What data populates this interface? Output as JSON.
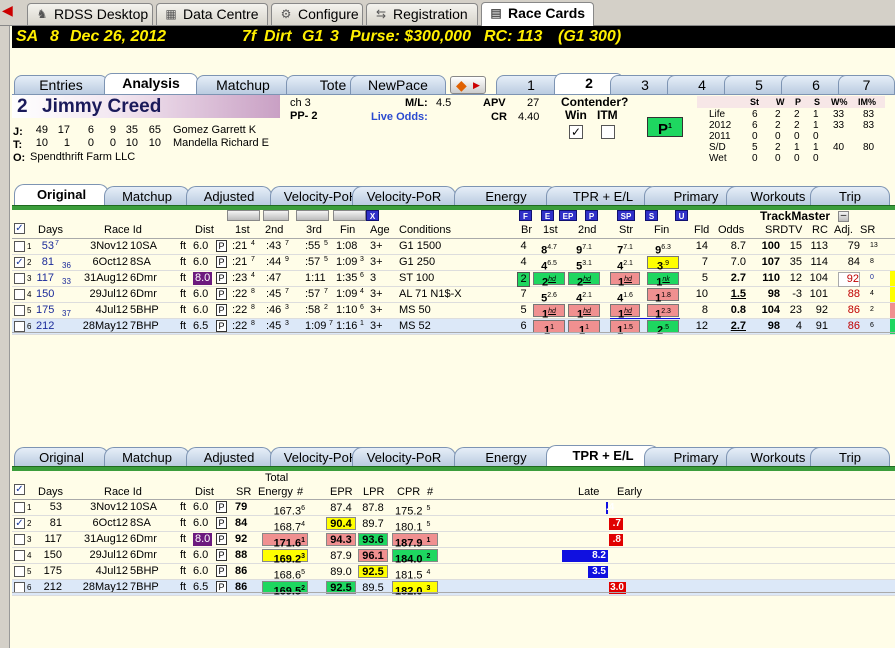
{
  "top_tabs": [
    {
      "label": "RDSS Desktop",
      "icon": "horse-icon"
    },
    {
      "label": "Data Centre",
      "icon": "grid-icon"
    },
    {
      "label": "Configure",
      "icon": "gear-icon"
    },
    {
      "label": "Registration",
      "icon": "arrows-icon"
    },
    {
      "label": "Race Cards",
      "icon": "book-icon"
    }
  ],
  "race_header": {
    "track": "SA",
    "race": "8",
    "date": "Dec 26, 2012",
    "dist": "7f",
    "surface": "Dirt",
    "grade": "G1",
    "num": "3",
    "purse": "Purse: $300,000",
    "rc": "RC: 113",
    "rc_grade": "(G1 300)"
  },
  "card_tabs": [
    "Entries",
    "Analysis",
    "Matchup",
    "Tote",
    "NewPace"
  ],
  "horse_tabs": [
    "1",
    "2",
    "3",
    "4",
    "5",
    "6",
    "7"
  ],
  "horse": {
    "number": "2",
    "name": "Jimmy Creed",
    "sex_age": "ch 3",
    "pp": "PP- 2",
    "ml_label": "M/L:",
    "ml": "4.5",
    "live_odds": "Live Odds:",
    "apv_label": "APV",
    "apv": "27",
    "cr_label": "CR",
    "cr": "4.40",
    "j_label": "J:",
    "jockey_stats": [
      "49",
      "17",
      "6",
      "9",
      "35",
      "65"
    ],
    "jockey": "Gomez Garrett K",
    "t_label": "T:",
    "trainer_stats": [
      "10",
      "1",
      "0",
      "0",
      "10",
      "10"
    ],
    "trainer": "Mandella Richard E",
    "o_label": "O:",
    "owner": "Spendthrift Farm LLC",
    "contender": "Contender?",
    "win": "Win",
    "itm": "ITM",
    "p_badge": "P",
    "p_sup": "1"
  },
  "record": {
    "headers": [
      "St",
      "W",
      "P",
      "S",
      "W%",
      "IM%"
    ],
    "rows": [
      {
        "label": "Life",
        "vals": [
          "6",
          "2",
          "2",
          "1",
          "33",
          "83"
        ]
      },
      {
        "label": "2012",
        "vals": [
          "6",
          "2",
          "2",
          "1",
          "33",
          "83"
        ]
      },
      {
        "label": "2011",
        "vals": [
          "0",
          "0",
          "0",
          "0",
          "",
          ""
        ]
      },
      {
        "label": "S/D",
        "vals": [
          "5",
          "2",
          "1",
          "1",
          "40",
          "80"
        ]
      },
      {
        "label": "Wet",
        "vals": [
          "0",
          "0",
          "0",
          "0",
          "",
          ""
        ]
      }
    ]
  },
  "sub_tabs": [
    "Original",
    "Matchup",
    "Adjusted",
    "Velocity-PoH",
    "Velocity-PoR",
    "Energy",
    "TPR + E/L",
    "Primary",
    "Workouts",
    "Trip"
  ],
  "upper": {
    "headers": {
      "days": "Days",
      "race_id": "Race Id",
      "dist": "Dist",
      "f1": "1st",
      "f2": "2nd",
      "f3": "3rd",
      "fin": "Fin",
      "age": "Age",
      "cond": "Conditions",
      "br": "Br",
      "c1": "1st",
      "c2": "2nd",
      "str": "Str",
      "cfin": "Fin",
      "fld": "Fld",
      "odds": "Odds",
      "srd": "SRDTV",
      "rc": "RC",
      "adj": "Adj.",
      "sr": "SR",
      "trackmaster": "TrackMaster"
    },
    "btns": {
      "x": "X",
      "F": "F",
      "E": "E",
      "EP": "EP",
      "P": "P",
      "SP": "SP",
      "S": "S",
      "U": "U",
      "minus": "–"
    },
    "rows": [
      {
        "n": "1",
        "days": "53",
        "dsup": "7",
        "sub": "",
        "date": "3Nov12",
        "track": "10SA",
        "surf": "ft",
        "dist": "6.0",
        "f1": ":21",
        "f1s": "4",
        "f2": ":43",
        "f2s": "7",
        "f3": ":55",
        "f3s": "5",
        "fin": "1:08",
        "fins": "",
        "age": "3+",
        "cond": "G1 1500",
        "br": "4",
        "c1": "8",
        "c1s": "4.7",
        "c2": "9",
        "c2s": "7.1",
        "str": "7",
        "strs": "7.1",
        "cf": "9",
        "cfs": "6.3",
        "fld": "14",
        "odds": "8.7",
        "srd": "100",
        "tv": "15",
        "rc": "113",
        "adj": "79",
        "sr": "13"
      },
      {
        "n": "2",
        "days": "81",
        "dsup": "",
        "sub": "36",
        "date": "6Oct12",
        "track": "8SA",
        "surf": "ft",
        "dist": "6.0",
        "f1": ":21",
        "f1s": "7",
        "f2": ":44",
        "f2s": "9",
        "f3": ":57",
        "f3s": "5",
        "fin": "1:09",
        "fins": "3",
        "age": "3+",
        "cond": "G1 250",
        "br": "4",
        "c1": "4",
        "c1s": "6.5",
        "c2": "5",
        "c2s": "3.1",
        "str": "4",
        "strs": "2.1",
        "cf": "3",
        "cfs": ".9",
        "fld": "7",
        "odds": "7.0",
        "srd": "107",
        "tv": "35",
        "rc": "114",
        "adj": "84",
        "sr": "8"
      },
      {
        "n": "3",
        "days": "117",
        "dsup": "",
        "sub": "33",
        "date": "31Aug12",
        "track": "6Dmr",
        "surf": "ft",
        "dist": "8.0",
        "f1": ":23",
        "f1s": "4",
        "f2": ":47",
        "f2s": "",
        "f3": "1:11",
        "f3s": "",
        "fin": "1:35",
        "fins": "6",
        "age": "3",
        "cond": "ST 100",
        "br": "2",
        "c1": "2",
        "c1s": "hd",
        "c2": "2",
        "c2s": "hd",
        "str": "1",
        "strs": "hd",
        "cf": "1",
        "cfs": "nk",
        "fld": "5",
        "odds": "2.7",
        "srd": "110",
        "tv": "12",
        "rc": "104",
        "adj": "92",
        "sr": "0"
      },
      {
        "n": "4",
        "days": "150",
        "dsup": "",
        "sub": "",
        "date": "29Jul12",
        "track": "6Dmr",
        "surf": "ft",
        "dist": "6.0",
        "f1": ":22",
        "f1s": "8",
        "f2": ":45",
        "f2s": "7",
        "f3": ":57",
        "f3s": "7",
        "fin": "1:09",
        "fins": "4",
        "age": "3+",
        "cond": "AL 71 N1$-X",
        "br": "7",
        "c1": "5",
        "c1s": "2.6",
        "c2": "4",
        "c2s": "2.1",
        "str": "4",
        "strs": "1.6",
        "cf": "1",
        "cfs": "1.8",
        "fld": "10",
        "odds": "1.5",
        "srd": "98",
        "tv": "-3",
        "rc": "101",
        "adj": "88",
        "sr": "4"
      },
      {
        "n": "5",
        "days": "175",
        "dsup": "",
        "sub": "37",
        "date": "4Jul12",
        "track": "5BHP",
        "surf": "ft",
        "dist": "6.0",
        "f1": ":22",
        "f1s": "8",
        "f2": ":46",
        "f2s": "3",
        "f3": ":58",
        "f3s": "2",
        "fin": "1:10",
        "fins": "6",
        "age": "3+",
        "cond": "MS 50",
        "br": "5",
        "c1": "1",
        "c1s": "hd",
        "c2": "1",
        "c2s": "hd",
        "str": "1",
        "strs": "hd",
        "cf": "1",
        "cfs": "2.3",
        "fld": "8",
        "odds": "0.8",
        "srd": "104",
        "tv": "23",
        "rc": "92",
        "adj": "86",
        "sr": "2"
      },
      {
        "n": "6",
        "days": "212",
        "dsup": "",
        "sub": "",
        "date": "28May12",
        "track": "7BHP",
        "surf": "ft",
        "dist": "6.5",
        "f1": ":22",
        "f1s": "8",
        "f2": ":45",
        "f2s": "3",
        "f3": "1:09",
        "f3s": "7",
        "fin": "1:16",
        "fins": "1",
        "age": "3+",
        "cond": "MS 52",
        "br": "6",
        "c1": "1",
        "c1s": "1",
        "c2": "1",
        "c2s": "1",
        "str": "1",
        "strs": "1.5",
        "cf": "2",
        "cfs": ".5",
        "fld": "12",
        "odds": "2.7",
        "srd": "98",
        "tv": "4",
        "rc": "91",
        "adj": "86",
        "sr": "6"
      }
    ]
  },
  "lower": {
    "headers": {
      "days": "Days",
      "race_id": "Race Id",
      "dist": "Dist",
      "sr": "SR",
      "total_energy": "Total",
      "energy": "Energy",
      "hash": "#",
      "epr": "EPR",
      "lpr": "LPR",
      "cpr": "CPR",
      "hash2": "#",
      "late": "Late",
      "early": "Early"
    },
    "rows": [
      {
        "n": "1",
        "days": "53",
        "date": "3Nov12",
        "track": "10SA",
        "surf": "ft",
        "dist": "6.0",
        "sr": "79",
        "te": "167.3",
        "tes": "6",
        "epr": "87.4",
        "lpr": "87.8",
        "cpr": "175.2",
        "cprs": "5",
        "late": ".4",
        "late_v": 0.4,
        "early": "",
        "early_v": 0
      },
      {
        "n": "2",
        "days": "81",
        "date": "6Oct12",
        "track": "8SA",
        "surf": "ft",
        "dist": "6.0",
        "sr": "84",
        "te": "168.7",
        "tes": "4",
        "epr": "90.4",
        "lpr": "89.7",
        "cpr": "180.1",
        "cprs": "5",
        "late": "",
        "late_v": 0,
        "early": ".7",
        "early_v": 0.7
      },
      {
        "n": "3",
        "days": "117",
        "date": "31Aug12",
        "track": "6Dmr",
        "surf": "ft",
        "dist": "8.0",
        "sr": "92",
        "te": "171.6",
        "tes": "1",
        "epr": "94.3",
        "lpr": "93.6",
        "cpr": "187.9",
        "cprs": "1",
        "late": "",
        "late_v": 0,
        "early": ".8",
        "early_v": 0.8
      },
      {
        "n": "4",
        "days": "150",
        "date": "29Jul12",
        "track": "6Dmr",
        "surf": "ft",
        "dist": "6.0",
        "sr": "88",
        "te": "169.2",
        "tes": "3",
        "epr": "87.9",
        "lpr": "96.1",
        "cpr": "184.0",
        "cprs": "2",
        "late": "8.2",
        "late_v": 8.2,
        "early": "",
        "early_v": 0
      },
      {
        "n": "5",
        "days": "175",
        "date": "4Jul12",
        "track": "5BHP",
        "surf": "ft",
        "dist": "6.0",
        "sr": "86",
        "te": "168.6",
        "tes": "5",
        "epr": "89.0",
        "lpr": "92.5",
        "cpr": "181.5",
        "cprs": "4",
        "late": "3.5",
        "late_v": 3.5,
        "early": "",
        "early_v": 0
      },
      {
        "n": "6",
        "days": "212",
        "date": "28May12",
        "track": "7BHP",
        "surf": "ft",
        "dist": "6.5",
        "sr": "86",
        "te": "169.5",
        "tes": "2",
        "epr": "92.5",
        "lpr": "89.5",
        "cpr": "182.0",
        "cprs": "3",
        "late": "",
        "late_v": 0,
        "early": "3.0",
        "early_v": 3.0
      }
    ]
  },
  "colors": {
    "green": "#1ed760",
    "pink": "#f09090",
    "yellow": "#ffff00",
    "purple": "#6c1a7e",
    "blue": "#1010e0",
    "red": "#e00000",
    "header_bg": "#000000",
    "header_fg": "#ffef00"
  }
}
